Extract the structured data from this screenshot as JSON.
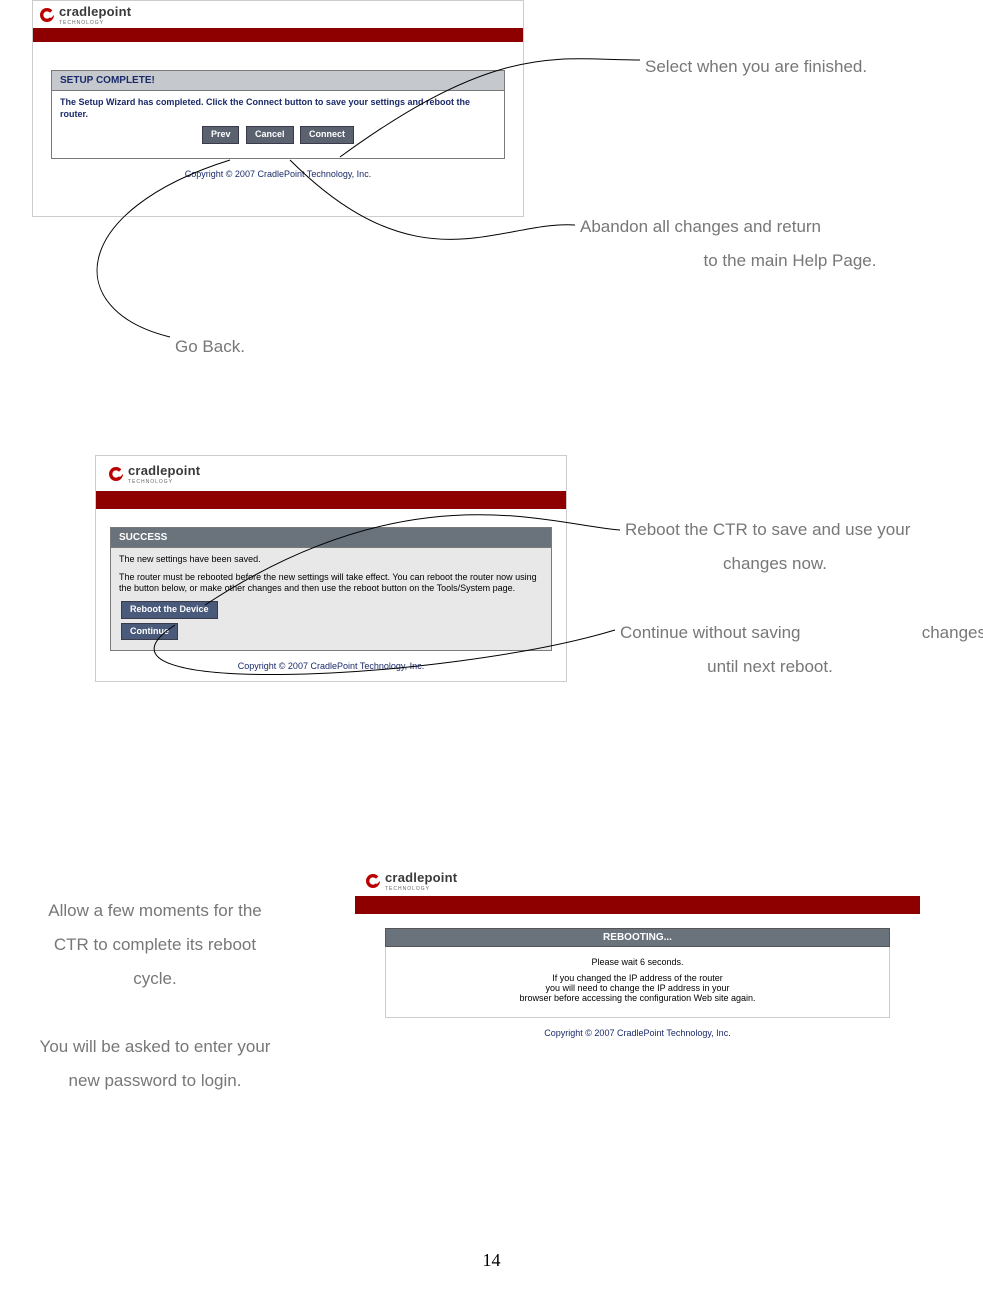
{
  "brand": "cradlepoint",
  "brand_sub": "TECHNOLOGY",
  "copyright": "Copyright © 2007 CradlePoint Technology, Inc.",
  "screenshot1": {
    "header": "SETUP COMPLETE!",
    "body": "The Setup Wizard has completed. Click the Connect button to save your settings and reboot the router.",
    "btn_prev": "Prev",
    "btn_cancel": "Cancel",
    "btn_connect": "Connect"
  },
  "screenshot2": {
    "header": "SUCCESS",
    "line1": "The new settings have been saved.",
    "line2": "The router must be rebooted before the new settings will take effect. You can reboot the router now using the button below, or make other changes and then use the reboot button on the Tools/System page.",
    "btn_reboot": "Reboot the Device",
    "btn_continue": "Continue"
  },
  "screenshot3": {
    "header": "REBOOTING...",
    "line1": "Please wait 6 seconds.",
    "line2": "If you changed the IP address of the router",
    "line3": "you will need to change the IP address in your",
    "line4": "browser before accessing the configuration Web site again."
  },
  "annotations": {
    "finished": "Select when you are finished.",
    "abandon1": "Abandon all changes and return",
    "abandon2": "to the main Help Page.",
    "goback": "Go Back.",
    "reboot1": "Reboot the CTR to save and use your",
    "reboot2": "changes now.",
    "continue1": "Continue without saving",
    "continue1b": "changes",
    "continue2": "until next reboot.",
    "allow1": "Allow a few moments for the",
    "allow2": "CTR to complete its reboot",
    "allow3": "cycle.",
    "allow4": "You will be asked to enter your",
    "allow5": "new password to login."
  },
  "page_number": "14"
}
